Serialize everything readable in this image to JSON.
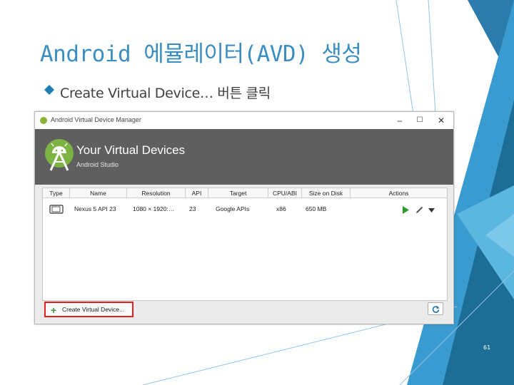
{
  "slide": {
    "title": "Android 에뮬레이터(AVD) 생성",
    "bullet_text": "Create Virtual Device… 버튼 클릭",
    "page_number": "61"
  },
  "avd_manager": {
    "window_title": "Android Virtual Device Manager",
    "header_title": "Your Virtual Devices",
    "header_subtitle": "Android Studio",
    "columns": [
      "Type",
      "Name",
      "Resolution",
      "API",
      "Target",
      "CPU/ABI",
      "Size on Disk",
      "Actions"
    ],
    "rows": [
      {
        "type_icon": "phone-device-icon",
        "name": "Nexus 5 API 23",
        "resolution": "1080 × 1920:…",
        "api": "23",
        "target": "Google APIs",
        "cpu": "x86",
        "size": "650 MB"
      }
    ],
    "create_button_label": "Create Virtual Device...",
    "icons": [
      "android-studio-icon",
      "minimize-icon",
      "maximize-icon",
      "close-icon",
      "play-icon",
      "edit-icon",
      "dropdown-arrow-icon",
      "refresh-icon"
    ]
  },
  "colors": {
    "title_blue": "#3b8ec2",
    "accent_teal": "#1d6e96",
    "header_grey": "#5f5f5f",
    "highlight_red": "#e02020",
    "play_green": "#2e9a2e"
  }
}
